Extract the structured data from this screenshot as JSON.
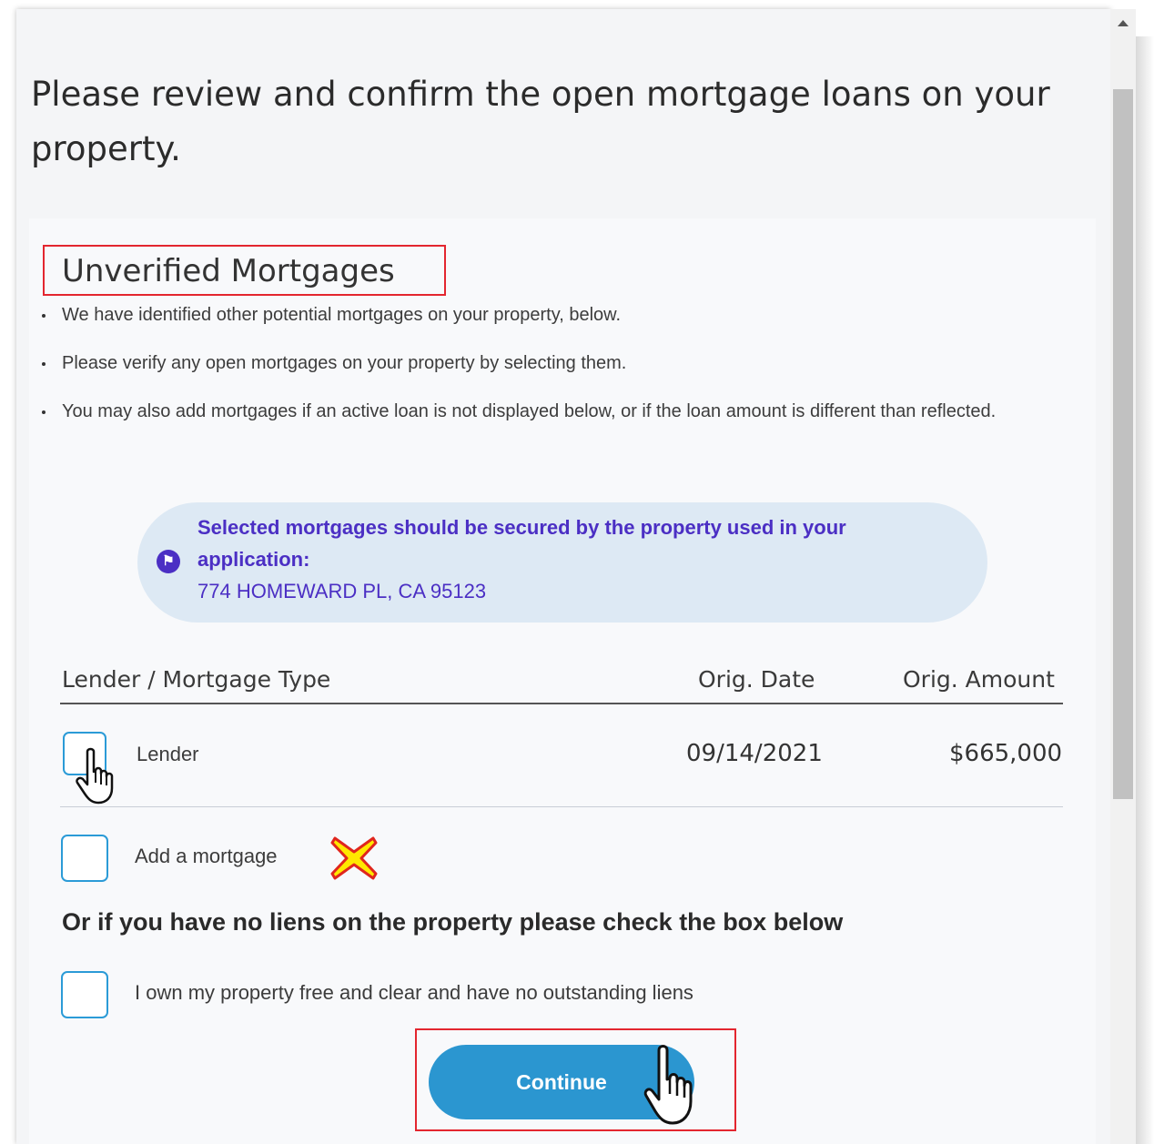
{
  "page": {
    "title": "Please review and confirm the open mortgage loans on your property."
  },
  "section": {
    "title": "Unverified Mortgages",
    "bullets": [
      "We have identified other potential mortgages on your property, below.",
      "Please verify any open mortgages on your property by selecting them.",
      "You may also add mortgages if an active loan is not displayed below, or if the loan amount is different than reflected."
    ]
  },
  "notice": {
    "icon": "flag-icon",
    "message": "Selected mortgages should be secured by the property used in your application:",
    "address": "774 HOMEWARD PL, CA 95123"
  },
  "table": {
    "headers": [
      "Lender / Mortgage Type",
      "Orig. Date",
      "Orig. Amount"
    ],
    "rows": [
      {
        "lender": "Lender",
        "date": "09/14/2021",
        "amount": "$665,000",
        "checked": false
      }
    ]
  },
  "add_mortgage": {
    "label": "Add a mortgage",
    "checked": false
  },
  "no_liens": {
    "heading": "Or if you have no liens on the property please check the box below",
    "checkbox_label": "I own my property free and clear and have no outstanding liens",
    "checked": false
  },
  "actions": {
    "continue_label": "Continue"
  },
  "colors": {
    "accent": "#2b96d0",
    "notice_bg": "#dde9f4",
    "notice_text": "#4b2fc4",
    "annotation_red": "#e3262f"
  }
}
